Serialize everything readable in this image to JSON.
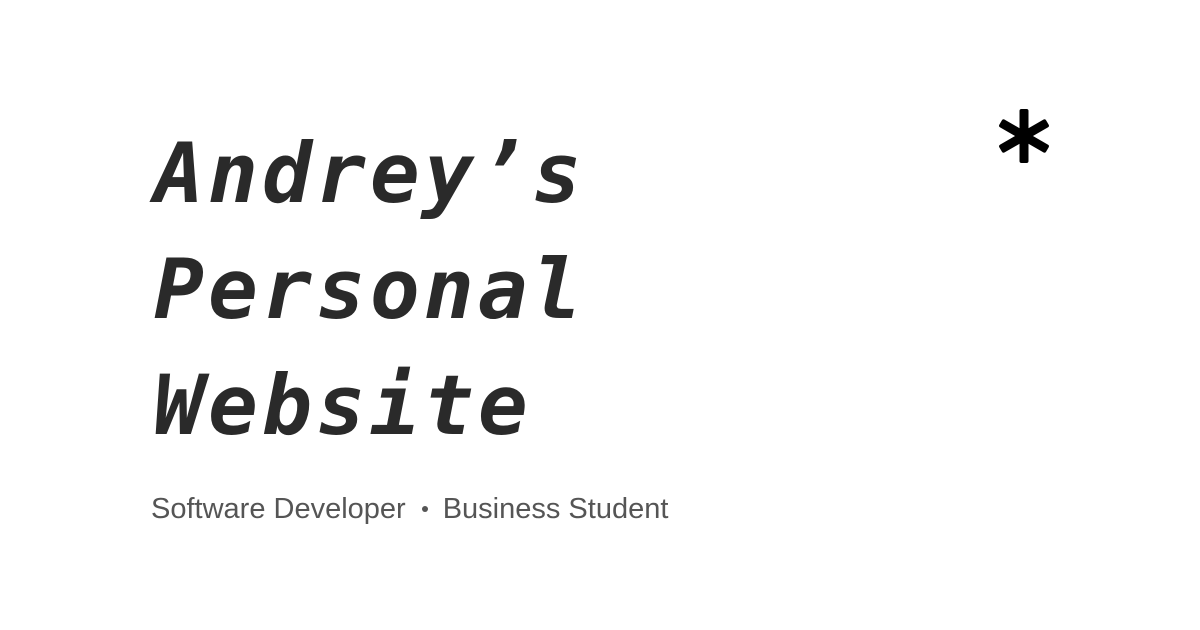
{
  "title": {
    "line1": "Andrey’s",
    "line2": "Personal",
    "line3": "Website"
  },
  "subtitle": {
    "role1": "Software Developer",
    "role2": "Business Student"
  },
  "decoration": {
    "icon": "asterisk-icon",
    "color": "#000000"
  },
  "colors": {
    "background": "#ffffff",
    "title": "#2a2a2a",
    "subtitle": "#555555"
  }
}
